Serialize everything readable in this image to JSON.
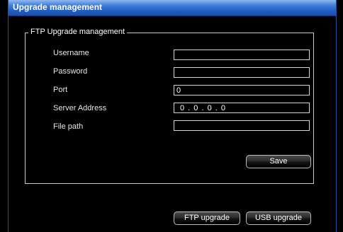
{
  "window": {
    "title": "Upgrade management"
  },
  "ftp": {
    "group_title": "FTP Upgrade management",
    "username": {
      "label": "Username",
      "value": ""
    },
    "password": {
      "label": "Password",
      "value": ""
    },
    "port": {
      "label": "Port",
      "value": "0"
    },
    "server_address": {
      "label": "Server Address",
      "value": "0 . 0 . 0 . 0"
    },
    "file_path": {
      "label": "File path",
      "value": ""
    },
    "save_label": "Save"
  },
  "actions": {
    "ftp_upgrade_label": "FTP upgrade",
    "usb_upgrade_label": "USB upgrade"
  }
}
